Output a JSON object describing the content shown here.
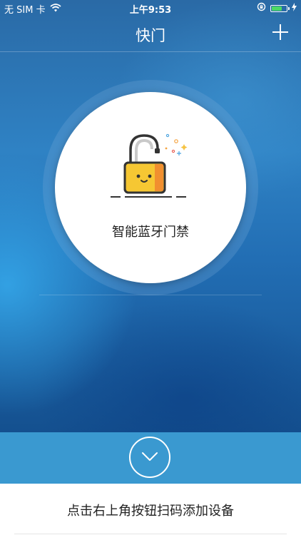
{
  "status_bar": {
    "carrier": "无 SIM 卡",
    "time": "上午9:53",
    "battery_color": "#4cd964"
  },
  "navbar": {
    "title": "快门",
    "add_icon": "plus-icon"
  },
  "device_card": {
    "label": "智能蓝牙门禁",
    "icon": "smiling-padlock-icon"
  },
  "expand_button_icon": "chevron-down-icon",
  "hint": {
    "text": "点击右上角按钮扫码添加设备"
  }
}
